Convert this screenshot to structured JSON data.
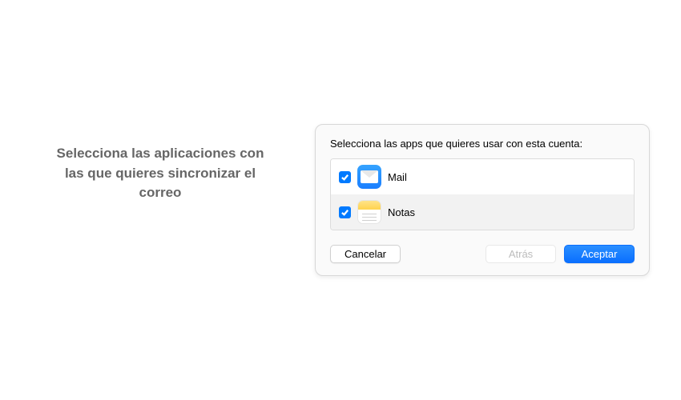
{
  "instruction": "Selecciona las aplicaciones con las que quieres sincronizar el correo",
  "dialog": {
    "title": "Selecciona las apps que quieres usar con esta cuenta:",
    "apps": [
      {
        "label": "Mail",
        "checked": true,
        "icon": "mail"
      },
      {
        "label": "Notas",
        "checked": true,
        "icon": "notes"
      }
    ],
    "buttons": {
      "cancel": "Cancelar",
      "back": "Atrás",
      "accept": "Aceptar"
    }
  }
}
